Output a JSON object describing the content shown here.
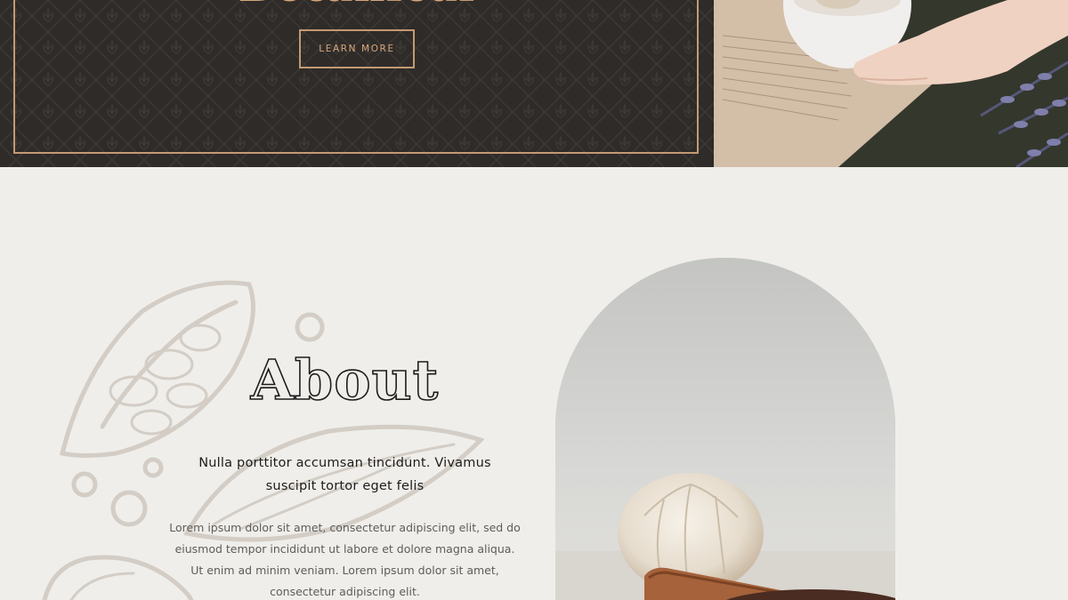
{
  "hero": {
    "title": "Botanical",
    "button_label": "LEARN MORE"
  },
  "about": {
    "title": "About",
    "subtitle": "Nulla porttitor accumsan tincidunt. Vivamus suscipit tortor eget felis",
    "body": "Lorem ipsum dolor sit amet, consectetur adipiscing elit, sed do eiusmod tempor incididunt ut labore et dolore magna aliqua. Ut enim ad minim veniam. Lorem ipsum dolor sit amet, consectetur adipiscing elit."
  },
  "colors": {
    "hero_background": "#2e2b29",
    "accent_gold": "#c39a72",
    "page_background": "#efeeea",
    "sketch_stroke": "#d3cdc6"
  },
  "icons": {
    "pattern": "lotus-pattern",
    "sketch": "cacao-pod-sketch"
  }
}
